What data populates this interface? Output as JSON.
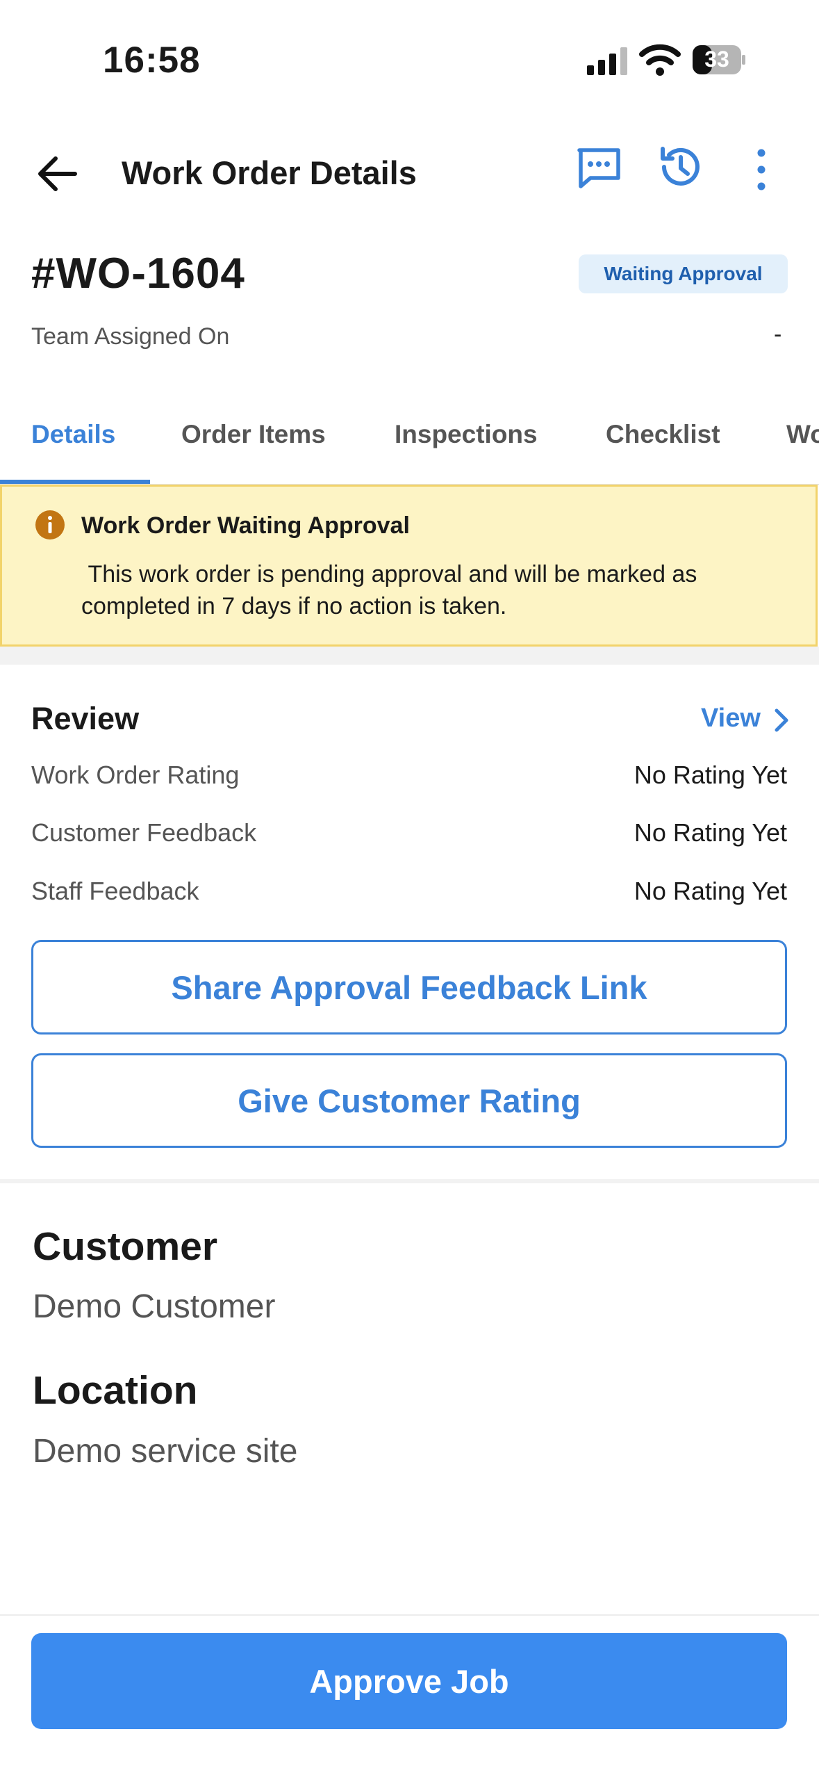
{
  "status_bar": {
    "time": "16:58",
    "battery": "33"
  },
  "header": {
    "title": "Work Order Details"
  },
  "work_order": {
    "id": "#WO-1604",
    "status": "Waiting Approval",
    "team_assigned_label": "Team Assigned On",
    "team_assigned_value": "-"
  },
  "tabs": [
    {
      "label": "Details"
    },
    {
      "label": "Order Items"
    },
    {
      "label": "Inspections"
    },
    {
      "label": "Checklist"
    },
    {
      "label": "Wo"
    }
  ],
  "alert": {
    "title": "Work Order Waiting Approval",
    "message": " This work order is pending approval and will be marked as completed in 7 days if no action is taken."
  },
  "review": {
    "title": "Review",
    "view_label": "View",
    "rows": [
      {
        "label": "Work Order Rating",
        "value": "No Rating Yet"
      },
      {
        "label": "Customer Feedback",
        "value": "No Rating Yet"
      },
      {
        "label": "Staff Feedback",
        "value": "No Rating Yet"
      }
    ],
    "share_button": "Share Approval Feedback Link",
    "rating_button": "Give Customer Rating"
  },
  "customer": {
    "title": "Customer",
    "value": "Demo Customer"
  },
  "location": {
    "title": "Location",
    "value": "Demo service site"
  },
  "footer": {
    "approve_button": "Approve Job"
  },
  "colors": {
    "accent": "#3b82d8",
    "alert_bg": "#fdf4c5",
    "alert_border": "#f2d36b",
    "alert_icon": "#c27513"
  }
}
